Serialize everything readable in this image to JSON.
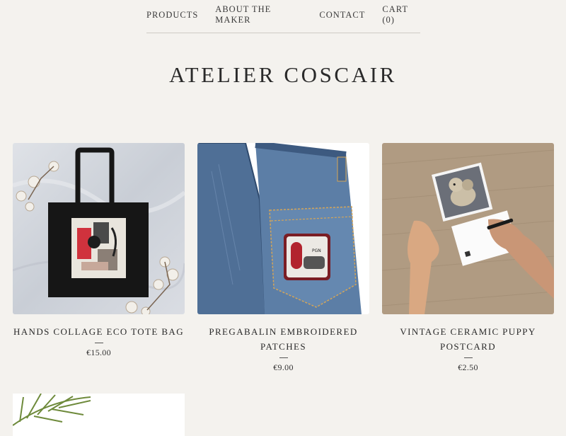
{
  "nav": {
    "products": "PRODUCTS",
    "about": "ABOUT THE MAKER",
    "contact": "CONTACT",
    "cart": "CART (0)"
  },
  "site_title": "ATELIER COSCAIR",
  "products": [
    {
      "name": "HANDS COLLAGE ECO TOTE BAG",
      "price": "€15.00"
    },
    {
      "name": "PREGABALIN EMBROIDERED PATCHES",
      "price": "€9.00"
    },
    {
      "name": "VINTAGE CERAMIC PUPPY POSTCARD",
      "price": "€2.50"
    }
  ],
  "patch_text": "PGN"
}
